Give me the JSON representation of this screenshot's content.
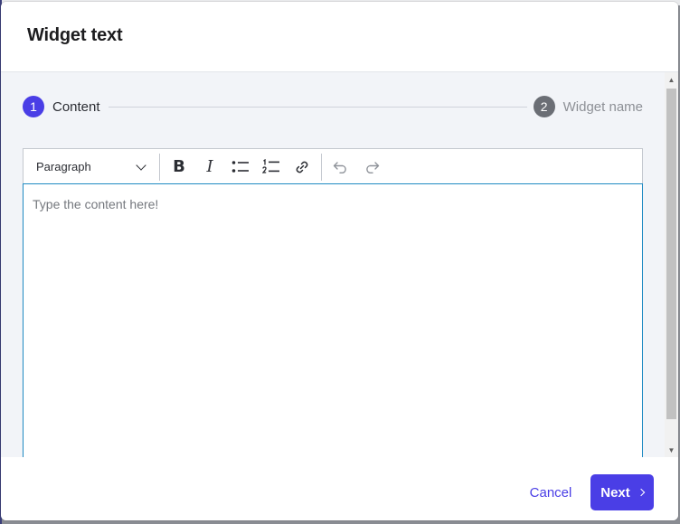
{
  "modal": {
    "title": "Widget text"
  },
  "stepper": {
    "steps": [
      {
        "number": "1",
        "label": "Content",
        "state": "active"
      },
      {
        "number": "2",
        "label": "Widget name",
        "state": "inactive"
      }
    ]
  },
  "editor": {
    "format_value": "Paragraph",
    "placeholder": "Type the content here!",
    "toolbar_icons": [
      "bold-icon",
      "italic-icon",
      "bulleted-list-icon",
      "numbered-list-icon",
      "link-icon",
      "undo-icon",
      "redo-icon"
    ],
    "bold_glyph": "B",
    "italic_glyph": "I"
  },
  "footer": {
    "cancel_label": "Cancel",
    "next_label": "Next"
  },
  "colors": {
    "accent": "#4a3ee6",
    "focus_border": "#1f8ac2",
    "body_bg": "#f2f4f8"
  }
}
